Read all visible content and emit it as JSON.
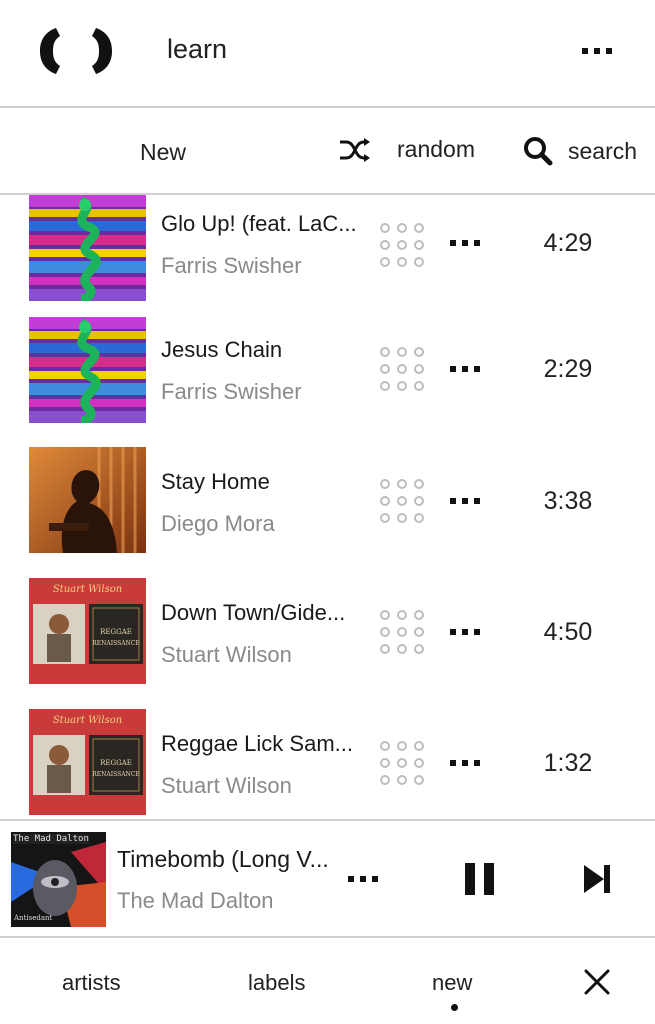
{
  "header": {
    "title": "learn",
    "logo_icon": "brackets-logo-icon",
    "more_icon": "more-icon"
  },
  "subnav": {
    "new_label": "New",
    "random_label": "random",
    "search_label": "search"
  },
  "tracks": [
    {
      "title": "Glo Up! (feat. LaC...",
      "artist": "Farris Swisher",
      "duration": "4:29"
    },
    {
      "title": "Jesus Chain",
      "artist": "Farris Swisher",
      "duration": "2:29"
    },
    {
      "title": "Stay Home",
      "artist": "Diego Mora",
      "duration": "3:38"
    },
    {
      "title": "Down Town/Gide...",
      "artist": "Stuart Wilson",
      "duration": "4:50"
    },
    {
      "title": "Reggae Lick Sam...",
      "artist": "Stuart Wilson",
      "duration": "1:32"
    }
  ],
  "album_text": {
    "stuart_wilson": "Stuart Wilson",
    "reggae": "REGGAE",
    "renaissance": "RENAISSANCE",
    "mad_dalton": "The Mad Dalton",
    "antisedant": "Antisedant"
  },
  "now_playing": {
    "title": "Timebomb (Long V...",
    "artist": "The Mad Dalton"
  },
  "bottom_nav": {
    "artists": "artists",
    "labels": "labels",
    "new": "new"
  },
  "colors": {
    "divider": "#cfcfcf",
    "secondary_text": "#8a8a8a",
    "album_red": "#c93a3b"
  }
}
